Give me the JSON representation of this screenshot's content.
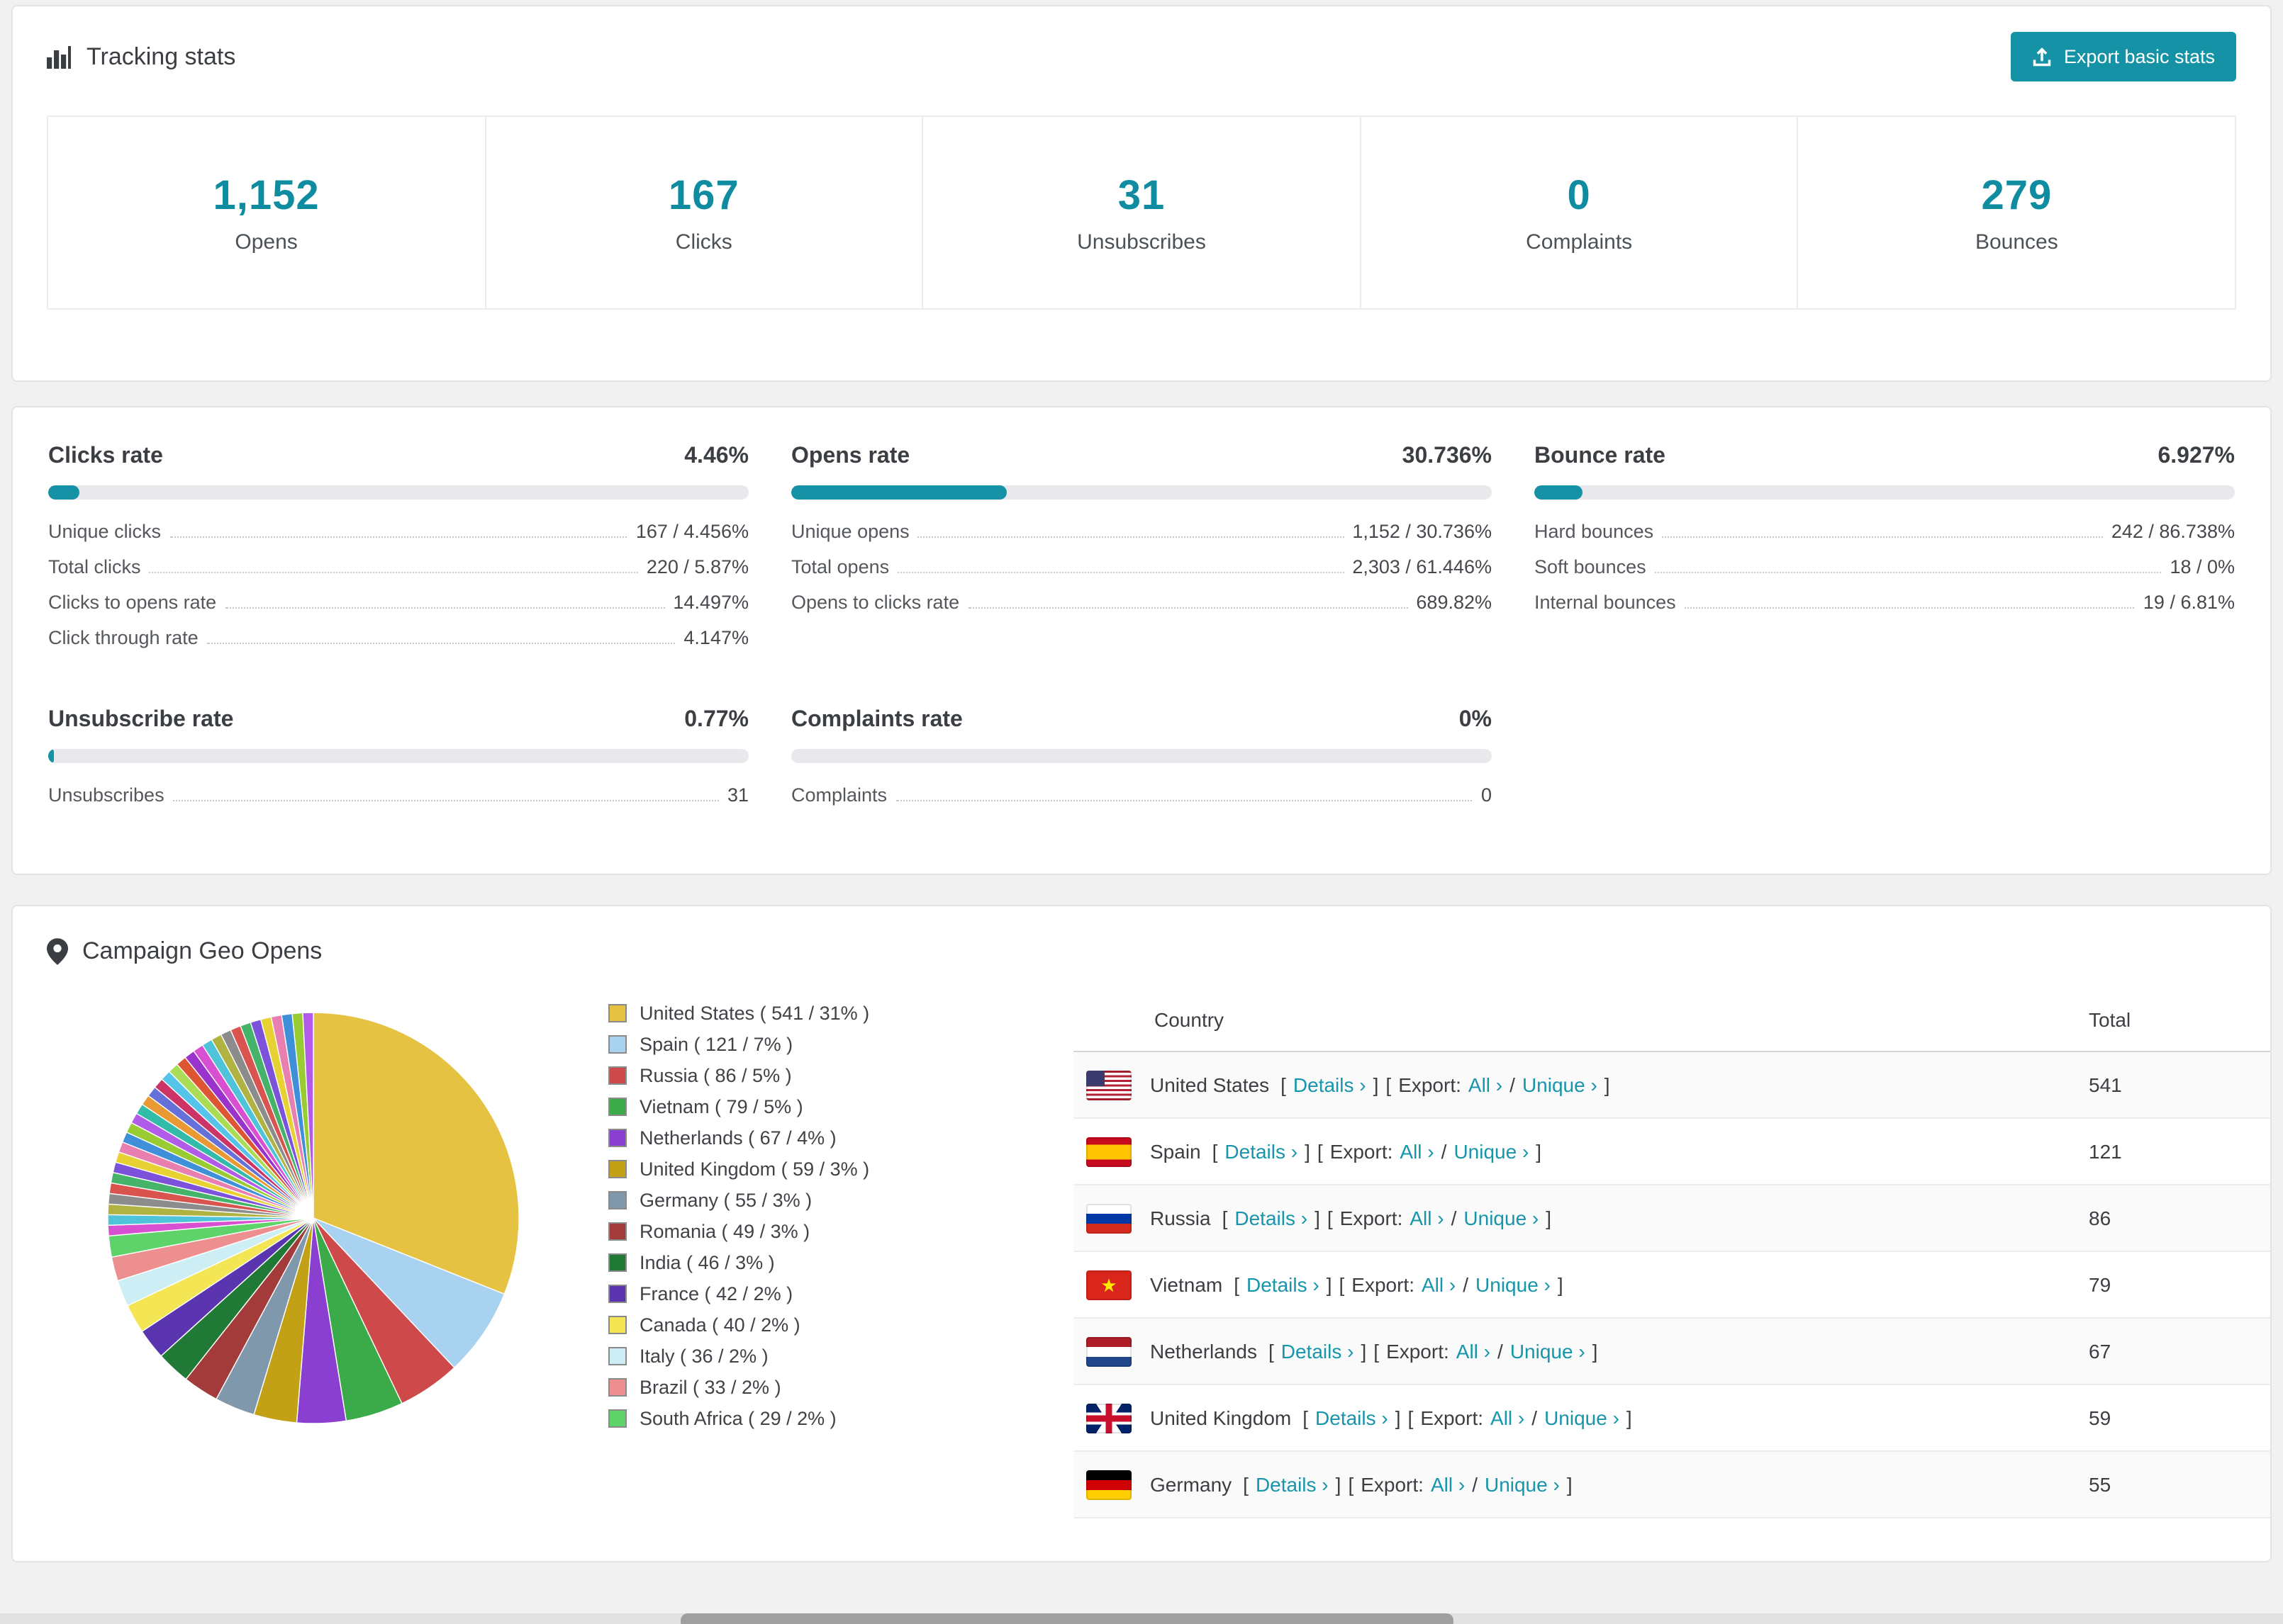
{
  "colors": {
    "accent": "#1592a6",
    "stat_number": "#0f8c9f",
    "link": "#1795ab"
  },
  "tracking": {
    "title": "Tracking stats",
    "export_button": "Export basic stats",
    "stats": [
      {
        "value": "1,152",
        "label": "Opens"
      },
      {
        "value": "167",
        "label": "Clicks"
      },
      {
        "value": "31",
        "label": "Unsubscribes"
      },
      {
        "value": "0",
        "label": "Complaints"
      },
      {
        "value": "279",
        "label": "Bounces"
      }
    ]
  },
  "rates": {
    "clicks": {
      "title": "Clicks rate",
      "value": "4.46%",
      "percent": 4.46,
      "rows": [
        {
          "label": "Unique clicks",
          "value": "167 / 4.456%"
        },
        {
          "label": "Total clicks",
          "value": "220 / 5.87%"
        },
        {
          "label": "Clicks to opens rate",
          "value": "14.497%"
        },
        {
          "label": "Click through rate",
          "value": "4.147%"
        }
      ]
    },
    "opens": {
      "title": "Opens rate",
      "value": "30.736%",
      "percent": 30.736,
      "rows": [
        {
          "label": "Unique opens",
          "value": "1,152 / 30.736%"
        },
        {
          "label": "Total opens",
          "value": "2,303 / 61.446%"
        },
        {
          "label": "Opens to clicks rate",
          "value": "689.82%"
        }
      ]
    },
    "bounce": {
      "title": "Bounce rate",
      "value": "6.927%",
      "percent": 6.927,
      "rows": [
        {
          "label": "Hard bounces",
          "value": "242 / 86.738%"
        },
        {
          "label": "Soft bounces",
          "value": "18 / 0%"
        },
        {
          "label": "Internal bounces",
          "value": "19 / 6.81%"
        }
      ]
    },
    "unsubscribe": {
      "title": "Unsubscribe rate",
      "value": "0.77%",
      "percent": 0.77,
      "rows": [
        {
          "label": "Unsubscribes",
          "value": "31"
        }
      ]
    },
    "complaints": {
      "title": "Complaints rate",
      "value": "0%",
      "percent": 0,
      "rows": [
        {
          "label": "Complaints",
          "value": "0"
        }
      ]
    }
  },
  "geo": {
    "title": "Campaign Geo Opens",
    "labels": {
      "lb": "[",
      "rb": "]",
      "details": "Details ›",
      "export": "Export:",
      "all": "All ›",
      "slash": "/",
      "unique": "Unique ›"
    },
    "table": {
      "headers": {
        "country": "Country",
        "total": "Total"
      },
      "rows": [
        {
          "country": "United States",
          "total": "541"
        },
        {
          "country": "Spain",
          "total": "121"
        },
        {
          "country": "Russia",
          "total": "86"
        },
        {
          "country": "Vietnam",
          "total": "79"
        },
        {
          "country": "Netherlands",
          "total": "67"
        },
        {
          "country": "United Kingdom",
          "total": "59"
        },
        {
          "country": "Germany",
          "total": "55"
        }
      ]
    }
  },
  "chart_data": {
    "type": "pie",
    "title": "Campaign Geo Opens",
    "legend_position": "right",
    "slices": [
      {
        "label": "United States",
        "value": 541,
        "pct": "31%",
        "color": "#e6c243",
        "legend": "United States ( 541 / 31% )"
      },
      {
        "label": "Spain",
        "value": 121,
        "pct": "7%",
        "color": "#a8d2f0",
        "legend": "Spain ( 121 / 7% )"
      },
      {
        "label": "Russia",
        "value": 86,
        "pct": "5%",
        "color": "#ce4a4a",
        "legend": "Russia ( 86 / 5% )"
      },
      {
        "label": "Vietnam",
        "value": 79,
        "pct": "5%",
        "color": "#3bab49",
        "legend": "Vietnam ( 79 / 5% )"
      },
      {
        "label": "Netherlands",
        "value": 67,
        "pct": "4%",
        "color": "#8a3fd1",
        "legend": "Netherlands ( 67 / 4% )"
      },
      {
        "label": "United Kingdom",
        "value": 59,
        "pct": "3%",
        "color": "#c2a117",
        "legend": "United Kingdom ( 59 / 3% )"
      },
      {
        "label": "Germany",
        "value": 55,
        "pct": "3%",
        "color": "#7f98ab",
        "legend": "Germany ( 55 / 3% )"
      },
      {
        "label": "Romania",
        "value": 49,
        "pct": "3%",
        "color": "#a43b3b",
        "legend": "Romania ( 49 / 3% )"
      },
      {
        "label": "India",
        "value": 46,
        "pct": "3%",
        "color": "#207a35",
        "legend": "India ( 46 / 3% )"
      },
      {
        "label": "France",
        "value": 42,
        "pct": "2%",
        "color": "#5b35b0",
        "legend": "France ( 42 / 2% )"
      },
      {
        "label": "Canada",
        "value": 40,
        "pct": "2%",
        "color": "#f3e553",
        "legend": "Canada ( 40 / 2% )"
      },
      {
        "label": "Italy",
        "value": 36,
        "pct": "2%",
        "color": "#cdeef4",
        "legend": "Italy ( 36 / 2% )"
      },
      {
        "label": "Brazil",
        "value": 33,
        "pct": "2%",
        "color": "#ee8f8f",
        "legend": "Brazil ( 33 / 2% )"
      },
      {
        "label": "South Africa",
        "value": 29,
        "pct": "2%",
        "color": "#5ed36a",
        "legend": "South Africa ( 29 / 2% )"
      }
    ],
    "other_total": 460,
    "other_slice_count": 32,
    "other_palette": [
      "#d94fd1",
      "#4fc3d9",
      "#b0b342",
      "#8c8c8c",
      "#d9534f",
      "#46b36b",
      "#7b52d9",
      "#e8d133",
      "#e87fb0",
      "#3f8fd9",
      "#99cc33",
      "#b05ce8",
      "#33bbaa",
      "#e89933",
      "#6670d9",
      "#cc3366",
      "#55c4e8",
      "#aadd55",
      "#dd5533",
      "#9933cc"
    ]
  }
}
